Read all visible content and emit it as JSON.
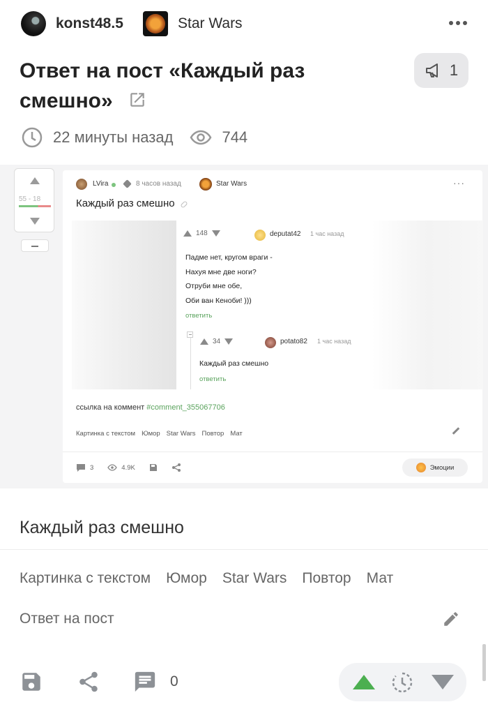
{
  "header": {
    "author": "konst48.5",
    "community": "Star Wars",
    "title": "Ответ на пост «Каждый раз смешно»",
    "reply_count": "1",
    "time": "22 минуты назад",
    "views": "744"
  },
  "embed": {
    "rating": "55 - 18",
    "author": "LVira",
    "time": "8 часов назад",
    "community": "Star Wars",
    "title": "Каждый раз смешно",
    "comment1": {
      "votes": "148",
      "user": "deputat42",
      "time": "1 час назад",
      "lines": [
        "Падме нет, кругом враги -",
        "Нахуя мне две ноги?",
        "Отруби мне обе,",
        "Оби ван Кеноби! )))"
      ],
      "reply": "ответить"
    },
    "comment2": {
      "votes": "34",
      "user": "potato82",
      "time": "1 час назад",
      "text": "Каждый раз смешно",
      "reply": "ответить"
    },
    "link_label": "ссылка на коммент",
    "link_value": "#comment_355067706",
    "tags": [
      "Картинка с текстом",
      "Юмор",
      "Star Wars",
      "Повтор",
      "Мат"
    ],
    "comments": "3",
    "views": "4.9K",
    "emotions": "Эмоции"
  },
  "body": {
    "title": "Каждый раз смешно",
    "tags": [
      "Картинка с текстом",
      "Юмор",
      "Star Wars",
      "Повтор",
      "Мат"
    ],
    "kind": "Ответ на пост"
  },
  "footer": {
    "comments": "0"
  },
  "icons": [
    "clock-icon",
    "eye-icon",
    "share-external-icon",
    "megaphone-icon",
    "more-icon",
    "save-icon",
    "share-icon",
    "comment-icon",
    "pencil-icon",
    "upvote-icon",
    "downvote-icon",
    "later-icon"
  ],
  "colors": {
    "accent": "#4caf50",
    "link": "#5aa35d"
  }
}
